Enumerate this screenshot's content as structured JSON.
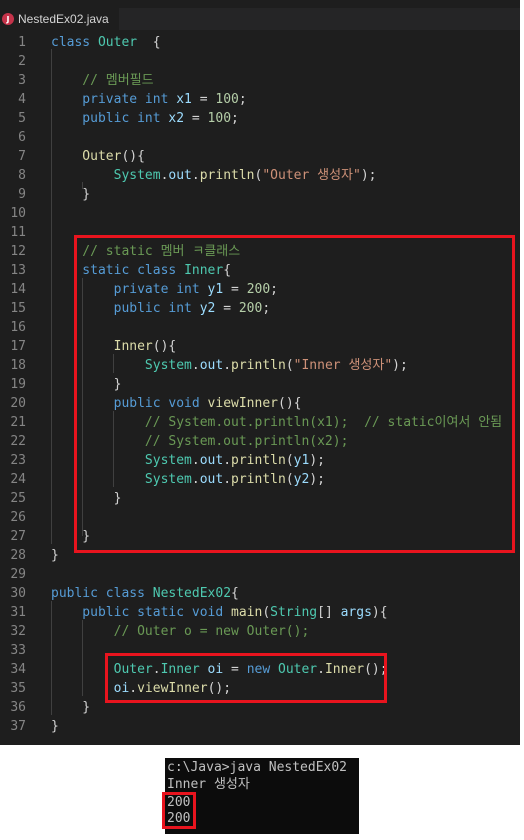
{
  "tab": {
    "filename": "NestedEx02.java",
    "icon": "java-file-icon",
    "icon_letter": "J"
  },
  "colors": {
    "highlight_box": "#e8141e",
    "editor_bg": "#1e1e1e"
  },
  "lines": [
    {
      "num": "1",
      "tokens": [
        [
          "kw",
          "class "
        ],
        [
          "ty",
          "Outer"
        ],
        [
          "",
          "  {"
        ]
      ]
    },
    {
      "num": "2",
      "tokens": []
    },
    {
      "num": "3",
      "tokens": [
        [
          "cm",
          "    // 멤버필드"
        ]
      ]
    },
    {
      "num": "4",
      "tokens": [
        [
          "kw",
          "    private int "
        ],
        [
          "vr",
          "x1"
        ],
        [
          "",
          " = "
        ],
        [
          "nm",
          "100"
        ],
        [
          "",
          ";"
        ]
      ]
    },
    {
      "num": "5",
      "tokens": [
        [
          "kw",
          "    public int "
        ],
        [
          "vr",
          "x2"
        ],
        [
          "",
          " = "
        ],
        [
          "nm",
          "100"
        ],
        [
          "",
          ";"
        ]
      ]
    },
    {
      "num": "6",
      "tokens": []
    },
    {
      "num": "7",
      "tokens": [
        [
          "fn",
          "    Outer"
        ],
        [
          "",
          "(){"
        ]
      ]
    },
    {
      "num": "8",
      "tokens": [
        [
          "ty",
          "        System"
        ],
        [
          "",
          "."
        ],
        [
          "vr",
          "out"
        ],
        [
          "",
          "."
        ],
        [
          "fn",
          "println"
        ],
        [
          "",
          "("
        ],
        [
          "st",
          "\"Outer 생성자\""
        ],
        [
          "",
          ");"
        ]
      ]
    },
    {
      "num": "9",
      "tokens": [
        [
          "",
          "    }"
        ]
      ]
    },
    {
      "num": "10",
      "tokens": []
    },
    {
      "num": "11",
      "tokens": []
    },
    {
      "num": "12",
      "tokens": [
        [
          "cm",
          "    // static 멤버 ㅋ클래스"
        ]
      ]
    },
    {
      "num": "13",
      "tokens": [
        [
          "kw",
          "    static class "
        ],
        [
          "ty",
          "Inner"
        ],
        [
          "",
          "{"
        ]
      ]
    },
    {
      "num": "14",
      "tokens": [
        [
          "kw",
          "        private int "
        ],
        [
          "vr",
          "y1"
        ],
        [
          "",
          " = "
        ],
        [
          "nm",
          "200"
        ],
        [
          "",
          ";"
        ]
      ]
    },
    {
      "num": "15",
      "tokens": [
        [
          "kw",
          "        public int "
        ],
        [
          "vr",
          "y2"
        ],
        [
          "",
          " = "
        ],
        [
          "nm",
          "200"
        ],
        [
          "",
          ";"
        ]
      ]
    },
    {
      "num": "16",
      "tokens": []
    },
    {
      "num": "17",
      "tokens": [
        [
          "fn",
          "        Inner"
        ],
        [
          "",
          "(){"
        ]
      ]
    },
    {
      "num": "18",
      "tokens": [
        [
          "ty",
          "            System"
        ],
        [
          "",
          "."
        ],
        [
          "vr",
          "out"
        ],
        [
          "",
          "."
        ],
        [
          "fn",
          "println"
        ],
        [
          "",
          "("
        ],
        [
          "st",
          "\"Inner 생성자\""
        ],
        [
          "",
          ");"
        ]
      ]
    },
    {
      "num": "19",
      "tokens": [
        [
          "",
          "        }"
        ]
      ]
    },
    {
      "num": "20",
      "tokens": [
        [
          "kw",
          "        public void "
        ],
        [
          "fn",
          "viewInner"
        ],
        [
          "",
          "(){"
        ]
      ]
    },
    {
      "num": "21",
      "tokens": [
        [
          "cm",
          "            // System.out.println(x1);  // static이여서 안됨"
        ]
      ]
    },
    {
      "num": "22",
      "tokens": [
        [
          "cm",
          "            // System.out.println(x2);"
        ]
      ]
    },
    {
      "num": "23",
      "tokens": [
        [
          "ty",
          "            System"
        ],
        [
          "",
          "."
        ],
        [
          "vr",
          "out"
        ],
        [
          "",
          "."
        ],
        [
          "fn",
          "println"
        ],
        [
          "",
          "("
        ],
        [
          "vr",
          "y1"
        ],
        [
          "",
          ");"
        ]
      ]
    },
    {
      "num": "24",
      "tokens": [
        [
          "ty",
          "            System"
        ],
        [
          "",
          "."
        ],
        [
          "vr",
          "out"
        ],
        [
          "",
          "."
        ],
        [
          "fn",
          "println"
        ],
        [
          "",
          "("
        ],
        [
          "vr",
          "y2"
        ],
        [
          "",
          ");"
        ]
      ]
    },
    {
      "num": "25",
      "tokens": [
        [
          "",
          "        }"
        ]
      ]
    },
    {
      "num": "26",
      "tokens": []
    },
    {
      "num": "27",
      "tokens": [
        [
          "",
          "    }"
        ]
      ]
    },
    {
      "num": "28",
      "tokens": [
        [
          "",
          "}"
        ]
      ]
    },
    {
      "num": "29",
      "tokens": []
    },
    {
      "num": "30",
      "tokens": [
        [
          "kw",
          "public class "
        ],
        [
          "ty",
          "NestedEx02"
        ],
        [
          "",
          "{"
        ]
      ]
    },
    {
      "num": "31",
      "tokens": [
        [
          "kw",
          "    public static void "
        ],
        [
          "fn",
          "main"
        ],
        [
          "",
          "("
        ],
        [
          "ty",
          "String"
        ],
        [
          "",
          "[] "
        ],
        [
          "vr",
          "args"
        ],
        [
          "",
          ")"
        ],
        [
          "",
          "{"
        ]
      ]
    },
    {
      "num": "32",
      "tokens": [
        [
          "cm",
          "        // Outer o = new Outer();"
        ]
      ]
    },
    {
      "num": "33",
      "tokens": []
    },
    {
      "num": "34",
      "tokens": [
        [
          "ty",
          "        Outer"
        ],
        [
          "",
          "."
        ],
        [
          "ty",
          "Inner"
        ],
        [
          " ",
          ""
        ],
        [
          "vr",
          " oi"
        ],
        [
          "",
          " = "
        ],
        [
          "kw",
          "new "
        ],
        [
          "ty",
          "Outer"
        ],
        [
          "",
          "."
        ],
        [
          "fn",
          "Inner"
        ],
        [
          "",
          "();"
        ]
      ]
    },
    {
      "num": "35",
      "tokens": [
        [
          "vr",
          "        oi"
        ],
        [
          "",
          "."
        ],
        [
          "fn",
          "viewInner"
        ],
        [
          "",
          "();"
        ]
      ]
    },
    {
      "num": "36",
      "tokens": [
        [
          "",
          "    }"
        ]
      ]
    },
    {
      "num": "37",
      "tokens": [
        [
          "",
          "}"
        ]
      ]
    }
  ],
  "console": {
    "lines": [
      "c:\\Java>java NestedEx02",
      "Inner 생성자",
      "200",
      "200"
    ]
  }
}
